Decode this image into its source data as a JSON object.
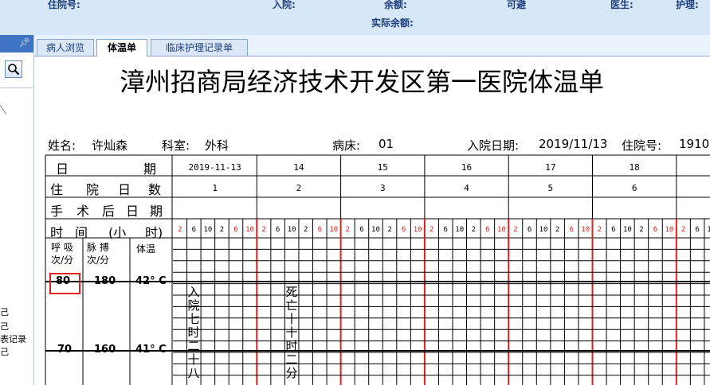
{
  "header": {
    "admission_no_label": "住院号:",
    "admit_label": "入院:",
    "balance_label": "余额:",
    "actual_balance_label": "实际余额:",
    "bed_label": "可避",
    "doctor_label": "医生:",
    "nurse_label": "护理:"
  },
  "sidebar": {
    "pin_icon": "pin-icon",
    "search_icon": "search-icon",
    "labels": [
      "己",
      "己",
      "表记录",
      "己"
    ]
  },
  "tabs": [
    {
      "label": "病人浏览",
      "active": false
    },
    {
      "label": "体温单",
      "active": true
    },
    {
      "label": "临床护理记录单",
      "active": false
    }
  ],
  "document": {
    "title": "漳州招商局经济技术开发区第一医院体温单",
    "patient": {
      "name_label": "姓名:",
      "name": "许灿森",
      "dept_label": "科室:",
      "dept": "外科",
      "bed_label": "病床:",
      "bed": "01",
      "admit_date_label": "入院日期:",
      "admit_date": "2019/11/13",
      "inpatient_no_label": "住院号:",
      "inpatient_no": "1910"
    },
    "row_labels": {
      "date": [
        "日",
        "期"
      ],
      "hospital_day": [
        "住",
        "院",
        "日",
        "数"
      ],
      "post_op": [
        "手",
        "术",
        "后",
        "日",
        "期"
      ],
      "time": [
        "时",
        "间",
        "(小",
        "时)"
      ]
    },
    "dates": [
      "2019-11-13",
      "14",
      "15",
      "16",
      "17",
      "18",
      ""
    ],
    "hospital_days": [
      "1",
      "2",
      "3",
      "4",
      "5",
      "6",
      ""
    ],
    "hour_ticks": [
      "2",
      "6",
      "10",
      "2",
      "6",
      "10"
    ],
    "col_headers": {
      "resp": [
        "呼 吸",
        "次/分"
      ],
      "pulse": [
        "脉 搏",
        "次/分"
      ],
      "temp": "体温"
    },
    "scale_rows": [
      {
        "resp": "80",
        "pulse": "180",
        "temp": "42° C",
        "resp_highlight": true
      },
      {
        "resp": "70",
        "pulse": "160",
        "temp": "41° C",
        "resp_highlight": false
      }
    ],
    "events": [
      {
        "day_index": 0,
        "text": [
          "入",
          "院",
          "七",
          "时",
          "二",
          "十",
          "八"
        ]
      },
      {
        "day_index": 1,
        "text": [
          "死",
          "亡",
          "十",
          "十",
          "时",
          "二",
          "分"
        ]
      }
    ],
    "colors": {
      "day_separator": "#e0201c",
      "tick_red": "#e0201c",
      "grid": "#000000",
      "highlight_box": "#e0201c"
    }
  }
}
